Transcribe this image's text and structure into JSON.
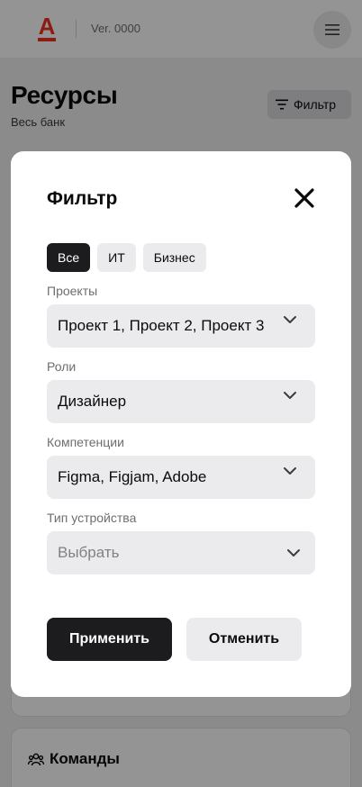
{
  "header": {
    "logo_letter": "А",
    "version": "Ver. 0000"
  },
  "page": {
    "title": "Ресурсы",
    "subtitle": "Весь банк",
    "filter_button": "Фильтр",
    "teams_label": "Команды"
  },
  "modal": {
    "title": "Фильтр",
    "chips": [
      {
        "label": "Все",
        "active": true
      },
      {
        "label": "ИТ",
        "active": false
      },
      {
        "label": "Бизнес",
        "active": false
      }
    ],
    "fields": [
      {
        "label": "Проекты",
        "value": "Проект 1, Проект 2, Проект 3"
      },
      {
        "label": "Роли",
        "value": "Дизайнер"
      },
      {
        "label": "Компетенции",
        "value": "Figma, Figjam, Adobe"
      },
      {
        "label": "Тип устройства",
        "placeholder": "Выбрать"
      }
    ],
    "apply_button": "Применить",
    "cancel_button": "Отменить"
  },
  "colors": {
    "brand": "#ef3124",
    "primary_button": "#1c1c1e",
    "field_bg": "#ebebee"
  },
  "icons": [
    "alfa-logo-icon",
    "hamburger-menu-icon",
    "filter-icon",
    "close-icon",
    "chevron-down-icon",
    "team-icon"
  ]
}
